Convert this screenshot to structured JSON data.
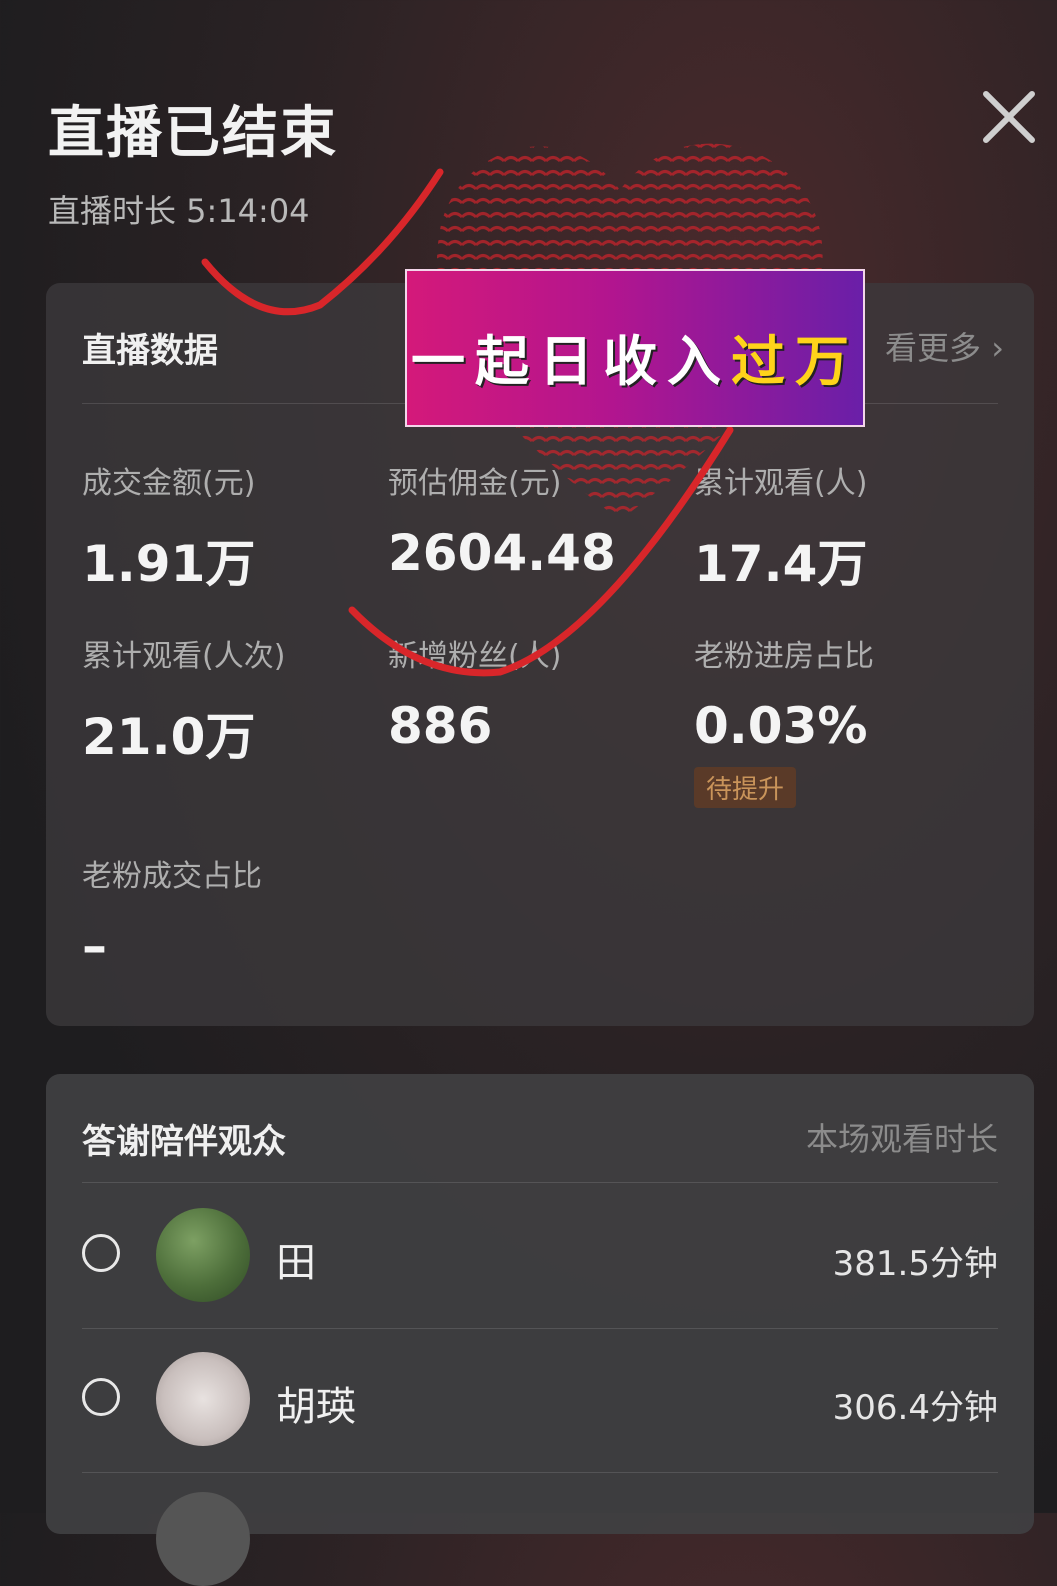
{
  "header": {
    "title": "直播已结束",
    "duration_label": "直播时长 5:14:04"
  },
  "stats_card": {
    "heading": "直播数据",
    "more_label": "看更多",
    "metrics": [
      {
        "label": "成交金额(元)",
        "value": "1.91万"
      },
      {
        "label": "预估佣金(元)",
        "value": "2604.48"
      },
      {
        "label": "累计观看(人)",
        "value": "17.4万"
      },
      {
        "label": "累计观看(人次)",
        "value": "21.0万"
      },
      {
        "label": "新增粉丝(人)",
        "value": "886"
      },
      {
        "label": "老粉进房占比",
        "value": "0.03%",
        "tag": "待提升"
      },
      {
        "label": "老粉成交占比",
        "value": "–"
      }
    ]
  },
  "audience_card": {
    "heading": "答谢陪伴观众",
    "column_label": "本场观看时长",
    "rows": [
      {
        "name": "田",
        "duration": "381.5分钟"
      },
      {
        "name": "胡瑛",
        "duration": "306.4分钟"
      }
    ]
  },
  "banner": {
    "text_main": "一起日收入",
    "text_highlight": "过万"
  },
  "colors": {
    "banner_pink": "#d4197a",
    "banner_purple": "#6a1fa8",
    "highlight_yellow": "#ffd31a",
    "mark_red": "#d8262a"
  }
}
